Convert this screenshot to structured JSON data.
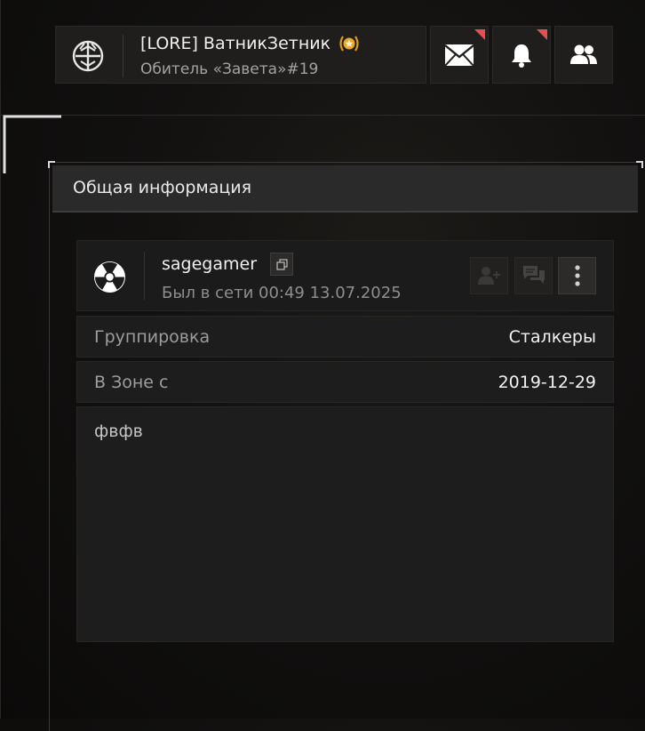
{
  "header": {
    "clan_name": "[LORE] ВатникЗетник",
    "faction_line": "Обитель «Завета»#19",
    "icons": {
      "emblem": "clan-emblem-icon",
      "medal": "medal-icon",
      "mail": "mail-icon",
      "notifications": "bell-icon",
      "friends": "friends-icon"
    },
    "badge_color": "#e4504f"
  },
  "panel": {
    "title": "Общая информация"
  },
  "user": {
    "username": "sagegamer",
    "last_seen": "Был в сети 00:49 13.07.2025",
    "icons": {
      "avatar": "radiation-icon",
      "copy": "copy-icon",
      "add_friend": "add-friend-icon",
      "message": "chat-icon",
      "more": "more-vertical-icon"
    }
  },
  "info_rows": [
    {
      "label": "Группировка",
      "value": "Сталкеры"
    },
    {
      "label": "В Зоне с",
      "value": "2019-12-29"
    }
  ],
  "about": {
    "text": "фвфв"
  }
}
